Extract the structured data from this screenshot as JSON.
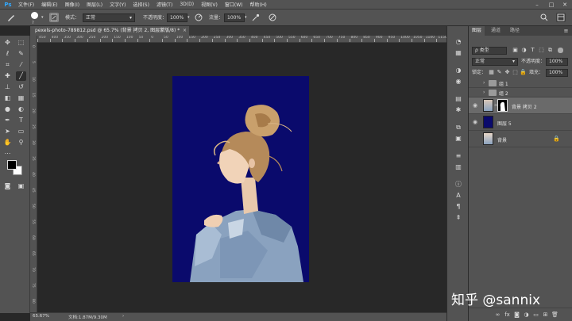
{
  "app": {
    "logo": "Ps"
  },
  "menu": [
    "文件(F)",
    "编辑(E)",
    "图像(I)",
    "图层(L)",
    "文字(Y)",
    "选择(S)",
    "滤镜(T)",
    "3D(D)",
    "视图(V)",
    "窗口(W)",
    "帮助(H)"
  ],
  "window_controls": {
    "minimize": "–",
    "maximize": "□",
    "close": "✕"
  },
  "options_bar": {
    "brush_size": "7",
    "mode_label": "模式：",
    "mode_value": "正常",
    "opacity_label": "不透明度：",
    "opacity_value": "100%",
    "flow_label": "流量：",
    "flow_value": "100%"
  },
  "document_tab": {
    "title": "pexels-photo-789812.psd @ 65.7% (背景 拷贝 2, 图层蒙版/8) *",
    "close": "×"
  },
  "ruler": {
    "top": [
      "450",
      "400",
      "350",
      "300",
      "250",
      "200",
      "150",
      "100",
      "50",
      "0",
      "50",
      "100",
      "150",
      "200",
      "250",
      "300",
      "350",
      "400",
      "450",
      "500",
      "550",
      "600",
      "650",
      "700",
      "750",
      "800",
      "850",
      "900",
      "950",
      "1000",
      "1050",
      "1100",
      "1150"
    ],
    "left": [
      "0",
      "5",
      "10",
      "15",
      "20",
      "25",
      "30",
      "35",
      "40",
      "45",
      "50",
      "55",
      "60",
      "65",
      "70",
      "75",
      "80"
    ]
  },
  "status": {
    "zoom": "65.67%",
    "doc_info": "文档:1.87M/9.30M",
    "arrow": "›"
  },
  "panel": {
    "tabs": [
      "图层",
      "通道",
      "路径"
    ],
    "filter_kind": "ρ 类型",
    "blend_mode": "正常",
    "opacity_label": "不透明度：",
    "opacity_value": "100%",
    "lock_label": "锁定：",
    "fill_label": "填充：",
    "fill_value": "100%",
    "layers": [
      {
        "name": "组 1",
        "type": "group",
        "visible": false,
        "selected": false
      },
      {
        "name": "组 2",
        "type": "group",
        "visible": false,
        "selected": false
      },
      {
        "name": "背景 拷贝 2",
        "type": "masked",
        "visible": true,
        "selected": true
      },
      {
        "name": "图层 5",
        "type": "fill",
        "visible": true,
        "selected": false
      },
      {
        "name": "背景",
        "type": "background",
        "visible": false,
        "selected": false
      }
    ]
  },
  "watermark": "知乎 @sannix",
  "colors": {
    "fill_layer": "#0a0a6c",
    "accent": "#31a8ff"
  }
}
